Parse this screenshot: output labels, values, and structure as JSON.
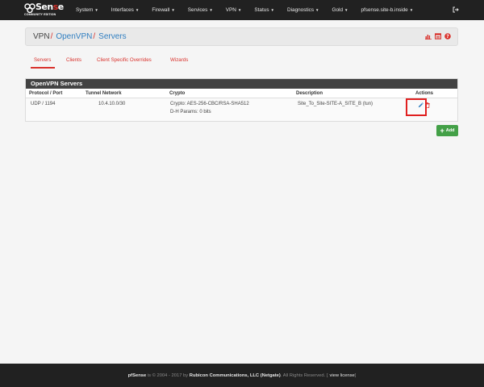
{
  "navbar": {
    "logo_text_a": "Sen",
    "logo_text_b": "s",
    "logo_text_c": "e",
    "logo_sub": "COMMUNITY EDITION",
    "items": [
      {
        "label": "System",
        "caret": "▼"
      },
      {
        "label": "Interfaces",
        "caret": "▼"
      },
      {
        "label": "Firewall",
        "caret": "▼"
      },
      {
        "label": "Services",
        "caret": "▼"
      },
      {
        "label": "VPN",
        "caret": "▼"
      },
      {
        "label": "Status",
        "caret": "▼"
      },
      {
        "label": "Diagnostics",
        "caret": "▼"
      },
      {
        "label": "Gold",
        "caret": "▼"
      },
      {
        "label": "pfsense.site-b.inside",
        "caret": "▼"
      }
    ]
  },
  "breadcrumb": {
    "root": "VPN",
    "sep": "/",
    "section": "OpenVPN",
    "page": "Servers"
  },
  "tabs": [
    {
      "label": "Servers",
      "active": true
    },
    {
      "label": "Clients",
      "active": false
    },
    {
      "label": "Client Specific Overrides",
      "active": false
    },
    {
      "label": "Wizards",
      "active": false
    }
  ],
  "panel": {
    "title": "OpenVPN Servers",
    "columns": [
      "Protocol / Port",
      "Tunnel Network",
      "Crypto",
      "Description",
      "Actions"
    ],
    "rows": [
      {
        "protocol_port": "UDP / 1194",
        "tunnel_network": "10.4.10.0/30",
        "crypto_line1": "Crypto: AES-256-CBC/RSA-SHA512",
        "crypto_line2": "D-H Params: 0 bits",
        "description": "Site_To_Site-SITE-A_SITE_B (tun)"
      }
    ]
  },
  "add_button": {
    "label": "Add"
  },
  "footer": {
    "brand": "pfSense",
    "text1": " is © 2004 - 2017 by ",
    "company": "Rubicon Communications, LLC (Netgate)",
    "text2": ". All Rights Reserved. [",
    "license": "view license",
    "text3": "]"
  },
  "colors": {
    "navbar_bg": "#212121",
    "accent_red": "#d9312b",
    "link_blue": "#317fc1",
    "panel_head": "#424242",
    "add_green": "#43a047",
    "highlight_red": "#e02020"
  },
  "icons": [
    "pfsense-logo-icon",
    "logout-icon",
    "chart-icon",
    "list-icon",
    "help-icon",
    "pencil-icon",
    "trash-icon",
    "plus-icon"
  ]
}
